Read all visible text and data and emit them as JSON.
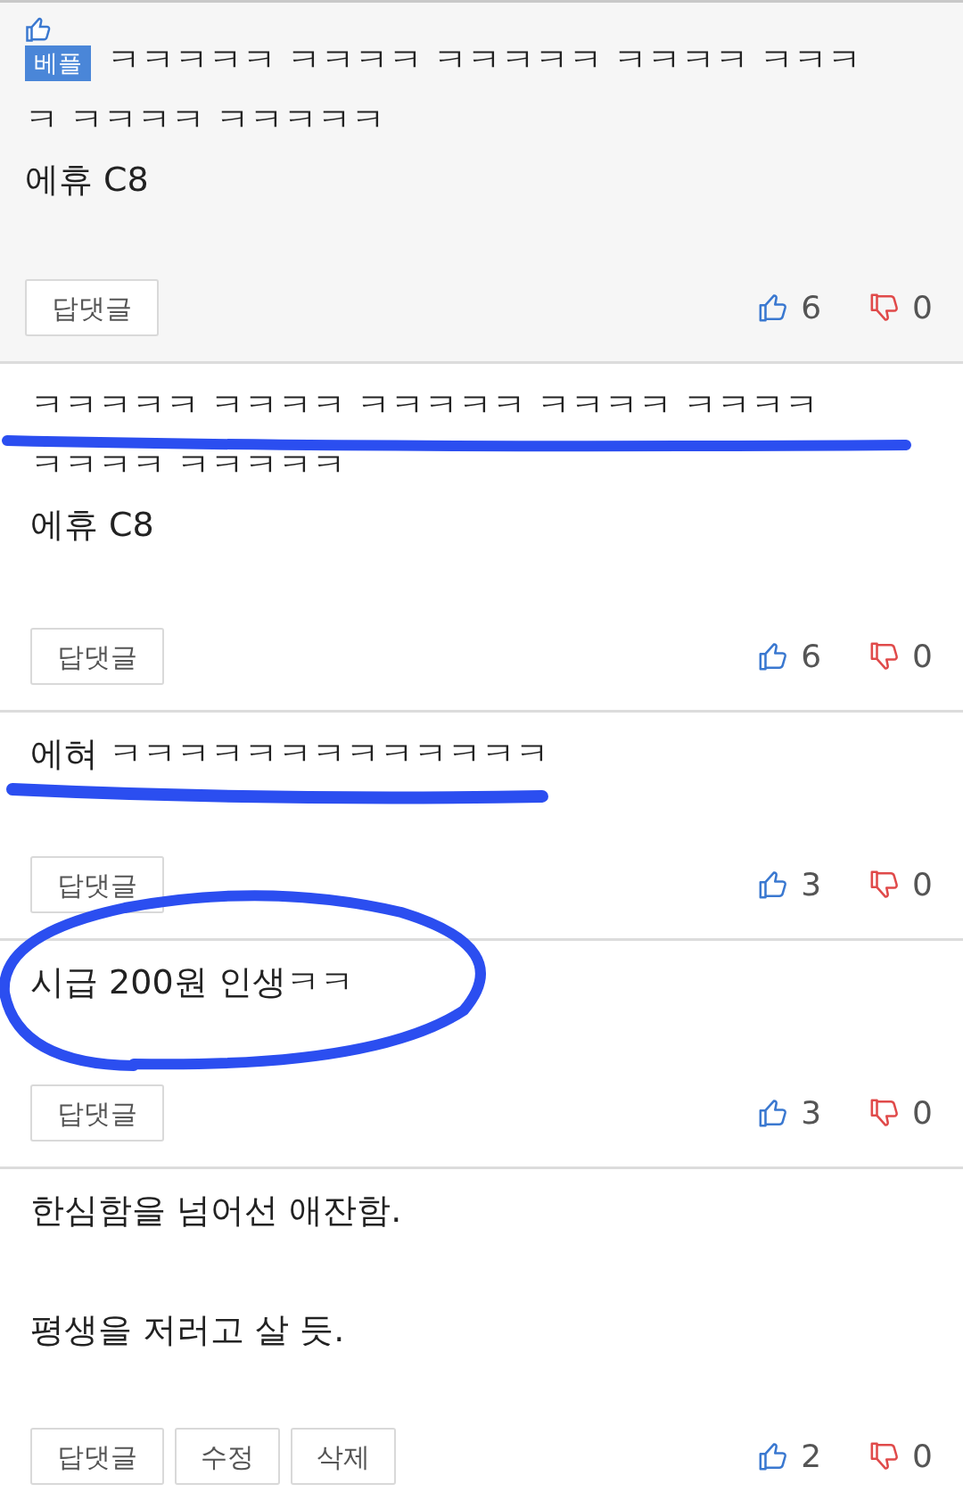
{
  "comments": [
    {
      "best": true,
      "badge": "베플",
      "lines": [
        "ㅋㅋㅋㅋㅋ ㅋㅋㅋㅋ ㅋㅋㅋㅋㅋ ㅋㅋㅋㅋ ㅋㅋㅋ",
        "ㅋ ㅋㅋㅋㅋ ㅋㅋㅋㅋㅋ",
        "에휴 C8"
      ],
      "buttons": [
        "답댓글"
      ],
      "likes": "6",
      "dislikes": "0"
    },
    {
      "best": false,
      "lines": [
        "ㅋㅋㅋㅋㅋ ㅋㅋㅋㅋ ㅋㅋㅋㅋㅋ ㅋㅋㅋㅋ ㅋㅋㅋㅋ",
        "ㅋㅋㅋㅋ ㅋㅋㅋㅋㅋ",
        "에휴 C8"
      ],
      "buttons": [
        "답댓글"
      ],
      "likes": "6",
      "dislikes": "0"
    },
    {
      "best": false,
      "lines": [
        "에혀 ㅋㅋㅋㅋㅋㅋㅋㅋㅋㅋㅋㅋㅋ"
      ],
      "buttons": [
        "답댓글"
      ],
      "likes": "3",
      "dislikes": "0"
    },
    {
      "best": false,
      "lines": [
        "시급 200원 인생ㅋㅋ"
      ],
      "buttons": [
        "답댓글"
      ],
      "likes": "3",
      "dislikes": "0"
    },
    {
      "best": false,
      "lines": [
        "한심함을 넘어선 애잔함.",
        "평생을 저러고 살 듯."
      ],
      "buttons": [
        "답댓글",
        "수정",
        "삭제"
      ],
      "likes": "2",
      "dislikes": "0"
    }
  ]
}
